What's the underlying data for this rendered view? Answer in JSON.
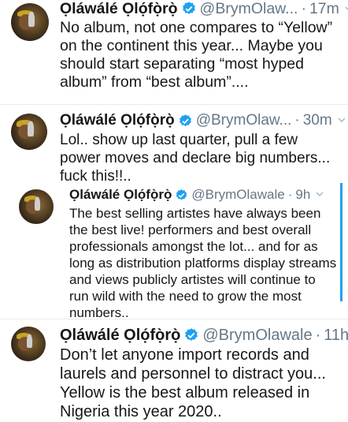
{
  "tweets": [
    {
      "name": "Ọláwálé Ọlọ́fọ̀rọ̀",
      "handle": "@BrymOlaw...",
      "dot": "·",
      "time": "17m",
      "text": "No album, not one compares to “Yellow” on the continent this year... Maybe you should start separating “most hyped album” from “best album”...."
    },
    {
      "name": "Ọláwálé Ọlọ́fọ̀rọ̀",
      "handle": "@BrymOlaw...",
      "dot": "·",
      "time": "30m",
      "text": "Lol.. show up last quarter, pull a few power moves and declare big numbers... fuck this!!.."
    },
    {
      "name": "Ọláwálé Ọlọ́fọ̀rọ̀",
      "handle": "@BrymOlawale",
      "dot": "·",
      "time": "9h",
      "text": "The best selling artistes have always been the best live! performers and best overall professionals amongst the lot... and for as long as distribution platforms display streams and views publicly artistes will continue to run wild with the need to grow the most numbers.."
    },
    {
      "name": "Ọláwálé Ọlọ́fọ̀rọ̀",
      "handle": "@BrymOlawale",
      "dot": "·",
      "time": "11h",
      "text": "Don’t let anyone import records and laurels and personnel to distract you... Yellow is the best album released in Nigeria this year 2020.."
    }
  ],
  "icons": {
    "verified": "verified-badge-icon",
    "menu": "chevron-down-icon"
  },
  "colors": {
    "verified": "#1da1f2",
    "secondary_text": "#657786"
  }
}
